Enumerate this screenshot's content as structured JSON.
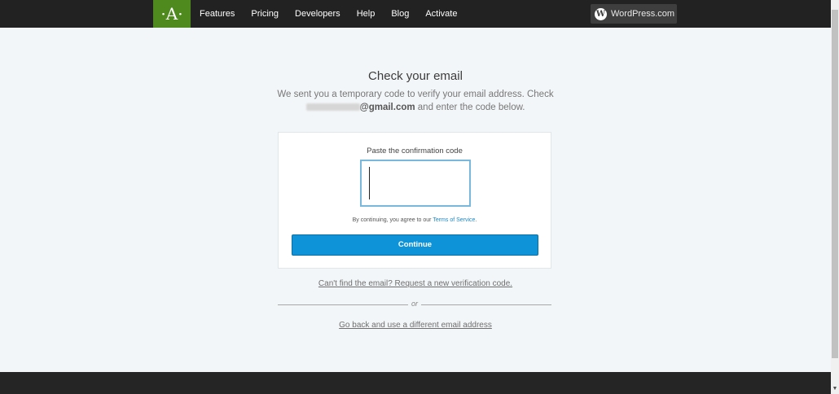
{
  "nav": {
    "logo": "·A·",
    "items": [
      "Features",
      "Pricing",
      "Developers",
      "Help",
      "Blog",
      "Activate"
    ],
    "wordpress_label": "WordPress.com",
    "wordpress_icon": "W"
  },
  "main": {
    "heading": "Check your email",
    "sub_line1": "We sent you a temporary code to verify your email address. Check",
    "email_domain": "@gmail.com",
    "sub_line2_end": " and enter the code below.",
    "code_label": "Paste the confirmation code",
    "code_value": "",
    "tos_prefix": "By continuing, you agree to our ",
    "tos_link": "Terms of Service",
    "tos_suffix": ".",
    "continue_label": "Continue",
    "resend_label": "Can't find the email? Request a new verification code.",
    "or_label": "or",
    "goback_label": "Go back and use a different email address"
  },
  "colors": {
    "nav_bg": "#222222",
    "logo_bg": "#4f8a1f",
    "page_bg": "#f3f6f8",
    "accent": "#0f93d8",
    "input_border": "#78b8dc"
  }
}
